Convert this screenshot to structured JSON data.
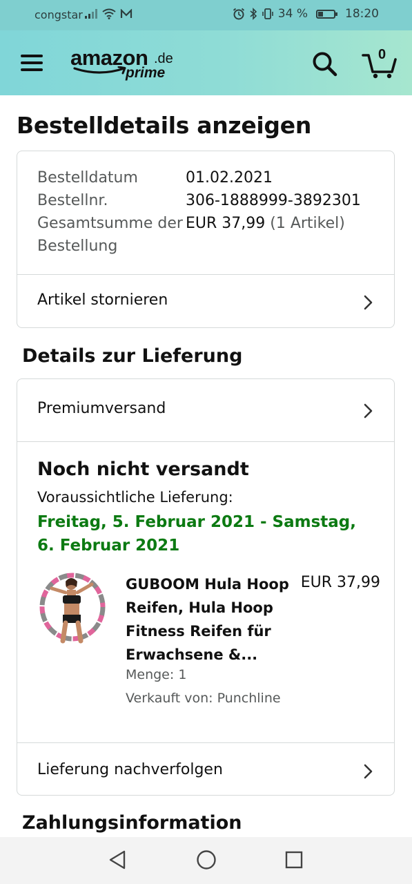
{
  "status_bar": {
    "carrier": "congstar",
    "battery": "34 %",
    "battery_level": 0.34,
    "time": "18:20",
    "icons": [
      "signal-icon",
      "wifi-icon",
      "mail-icon",
      "alarm-icon",
      "bluetooth-icon",
      "vibrate-icon",
      "battery-icon"
    ]
  },
  "header": {
    "logo_word": "amazon",
    "logo_tld": ".de",
    "logo_prime": "prime",
    "cart_count": "0",
    "icons": [
      "menu-icon",
      "search-icon",
      "cart-icon"
    ],
    "background": "#8fdcd6"
  },
  "page": {
    "title": "Bestelldetails anzeigen"
  },
  "order_summary": {
    "rows": [
      {
        "key": "Bestelldatum",
        "value": "01.02.2021"
      },
      {
        "key": "Bestellnr.",
        "value": "306-1888999-3892301"
      },
      {
        "key": "Gesamtsumme der Bestellung",
        "value": "EUR 37,99",
        "extra": "(1 Artikel)"
      }
    ],
    "cancel_label": "Artikel stornieren"
  },
  "delivery": {
    "section_title": "Details zur Lieferung",
    "shipping_method": "Premiumversand",
    "status": "Noch nicht versandt",
    "estimate_prefix": "Voraussichtliche Lieferung:",
    "estimate_date": "Freitag, 5. Februar 2021 - Samstag, 6. Februar 2021",
    "date_color": "#0c7a12",
    "item": {
      "title": "GUBOOM Hula Hoop Reifen, Hula Hoop Fitness Reifen für Erwachsene &...",
      "price": "EUR 37,99",
      "quantity": "Menge: 1",
      "seller": "Verkauft von: Punchline"
    },
    "track_label": "Lieferung nachverfolgen"
  },
  "payment": {
    "section_title": "Zahlungsinformation"
  },
  "nav_bar": {
    "icons": [
      "back-icon",
      "home-icon",
      "recents-icon"
    ]
  }
}
